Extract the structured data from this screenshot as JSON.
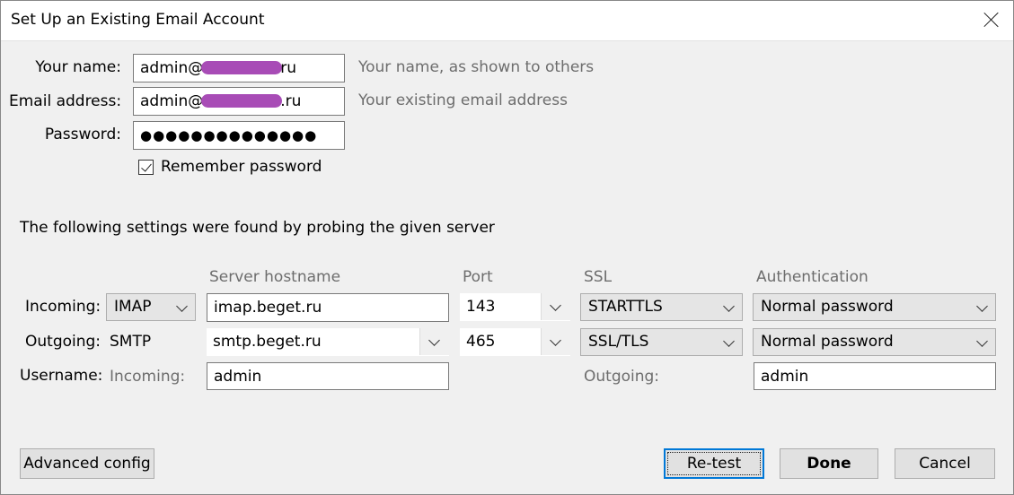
{
  "window": {
    "title": "Set Up an Existing Email Account"
  },
  "account": {
    "name_label": "Your name:",
    "name_value_prefix": "admin@",
    "name_value_suffix": "ru",
    "name_hint": "Your name, as shown to others",
    "email_label": "Email address:",
    "email_value_prefix": "admin@",
    "email_value_suffix": ".ru",
    "email_hint": "Your existing email address",
    "password_label": "Password:",
    "password_value": "●●●●●●●●●●●●●●",
    "remember_label": "Remember password",
    "remember_checked": true
  },
  "probe_message": "The following settings were found by probing the given server",
  "server": {
    "headers": {
      "hostname": "Server hostname",
      "port": "Port",
      "ssl": "SSL",
      "auth": "Authentication"
    },
    "incoming": {
      "label": "Incoming:",
      "protocol": "IMAP",
      "hostname": "imap.beget.ru",
      "port": "143",
      "ssl": "STARTTLS",
      "auth": "Normal password"
    },
    "outgoing": {
      "label": "Outgoing:",
      "protocol": "SMTP",
      "hostname": "smtp.beget.ru",
      "port": "465",
      "ssl": "SSL/TLS",
      "auth": "Normal password"
    },
    "username": {
      "label": "Username:",
      "incoming_label": "Incoming:",
      "incoming_value": "admin",
      "outgoing_label": "Outgoing:",
      "outgoing_value": "admin"
    }
  },
  "buttons": {
    "advanced": "Advanced config",
    "retest": "Re-test",
    "done": "Done",
    "cancel": "Cancel"
  },
  "colors": {
    "accent": "#0078d7",
    "redaction": "#a84cb6"
  }
}
